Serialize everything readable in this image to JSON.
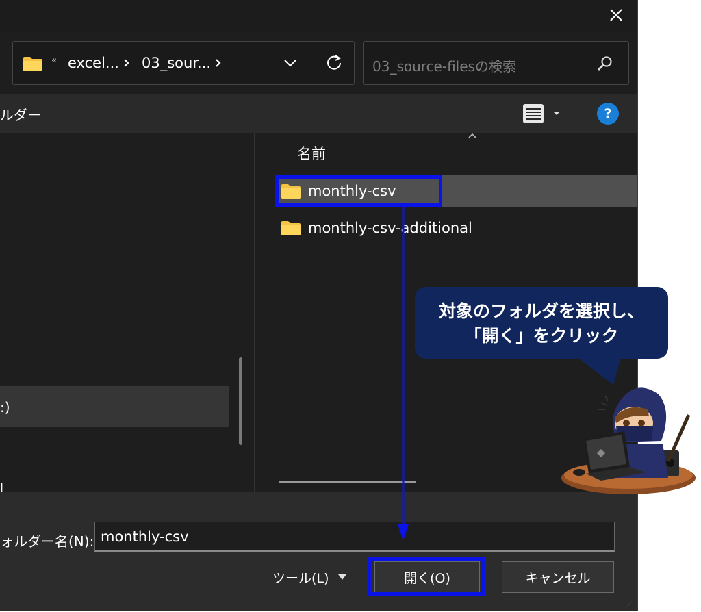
{
  "titlebar": {
    "close_icon": "close-icon"
  },
  "address_bar": {
    "folder_icon": "folder-icon",
    "overflow_chevron": "«",
    "breadcrumbs": [
      "excel...",
      "03_sour..."
    ],
    "dropdown_icon": "chevron-down-icon",
    "refresh_icon": "refresh-icon"
  },
  "search": {
    "placeholder": "03_source-filesの検索",
    "icon": "search-icon"
  },
  "toolbar": {
    "label": "ルダー",
    "view_icon": "list-view-icon",
    "help_label": "?"
  },
  "nav_pane": {
    "selected_text": ":)",
    "bottom_fragment": "l"
  },
  "file_list": {
    "column_header": "名前",
    "items": [
      {
        "name": "monthly-csv",
        "type": "folder",
        "selected": true
      },
      {
        "name": "monthly-csv-additional",
        "type": "folder",
        "selected": false
      }
    ]
  },
  "footer": {
    "folder_name_label": "ォルダー名(N):",
    "folder_name_value": "monthly-csv",
    "tools_label": "ツール(L)",
    "open_label": "開く(O)",
    "cancel_label": "キャンセル"
  },
  "annotation": {
    "callout_line1": "対象のフォルダを選択し、",
    "callout_line2": "「開く」をクリック",
    "highlight_color": "#0a14e8",
    "callout_color": "#10265c"
  },
  "colors": {
    "dialog_bg": "#1e1e1e",
    "selection": "#505050",
    "help_blue": "#1a7fd6",
    "folder_yellow": "#f5c344"
  }
}
